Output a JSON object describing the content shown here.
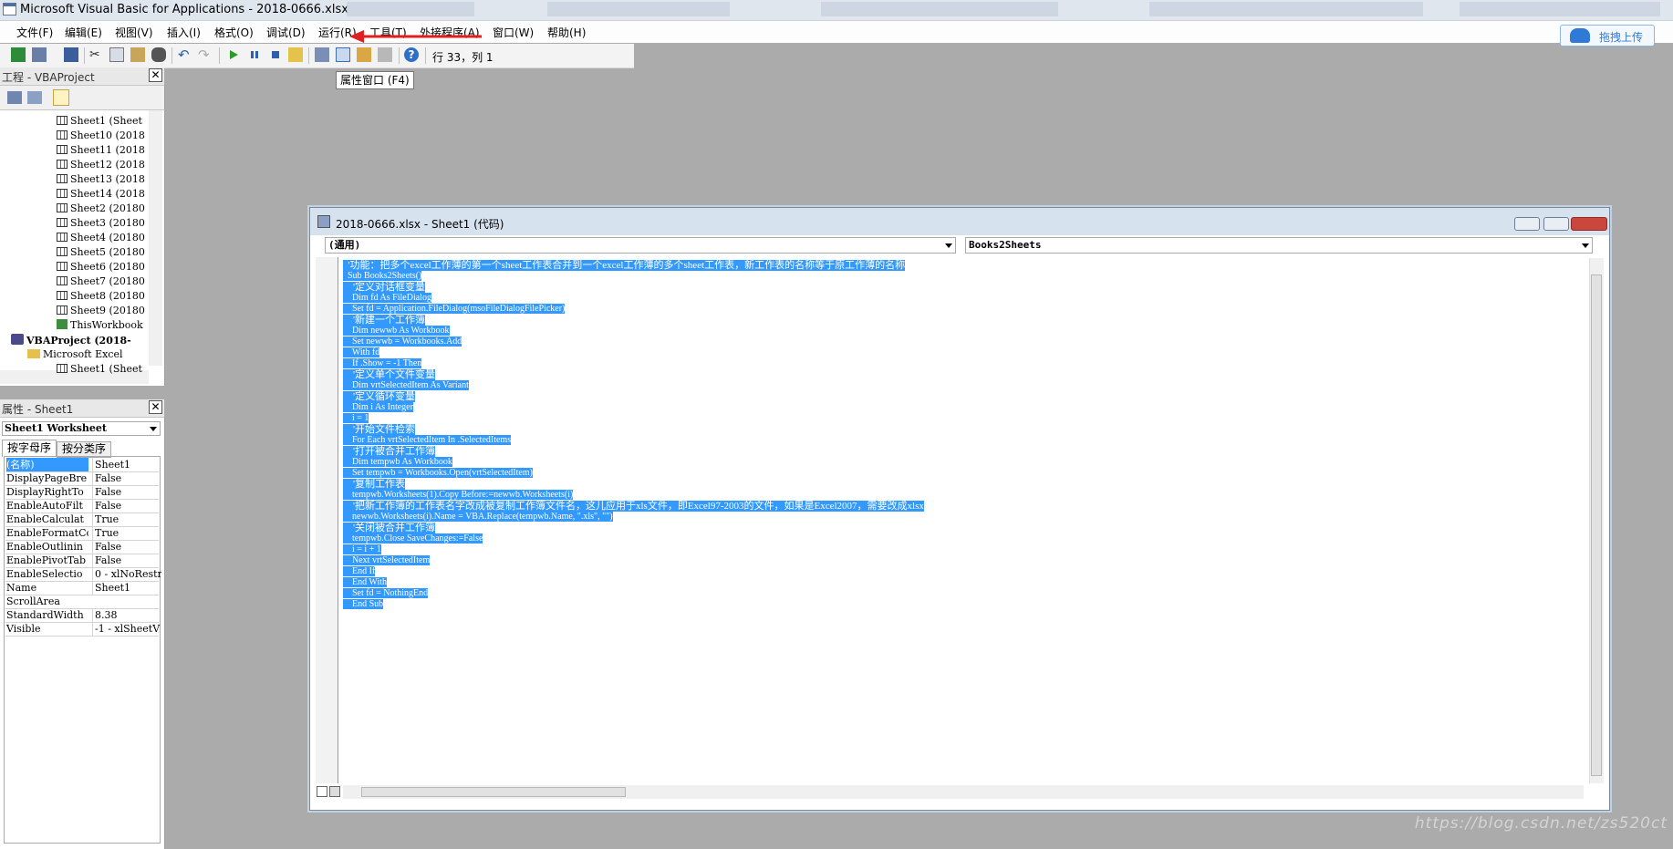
{
  "window": {
    "title": "Microsoft Visual Basic for Applications - 2018-0666.xlsx"
  },
  "menu": {
    "items": [
      "文件(F)",
      "编辑(E)",
      "视图(V)",
      "插入(I)",
      "格式(O)",
      "调试(D)",
      "运行(R)",
      "工具(T)",
      "外接程序(A)",
      "窗口(W)",
      "帮助(H)"
    ]
  },
  "upload_button": {
    "label": "拖拽上传"
  },
  "toolbar": {
    "position_text": "行 33，列 1",
    "tooltip": "属性窗口 (F4)"
  },
  "project_pane": {
    "title": "工程 - VBAProject",
    "tree": [
      {
        "label": "Sheet1 (Sheet",
        "kind": "sheet"
      },
      {
        "label": "Sheet10 (2018",
        "kind": "sheet"
      },
      {
        "label": "Sheet11 (2018",
        "kind": "sheet"
      },
      {
        "label": "Sheet12 (2018",
        "kind": "sheet"
      },
      {
        "label": "Sheet13 (2018",
        "kind": "sheet"
      },
      {
        "label": "Sheet14 (2018",
        "kind": "sheet"
      },
      {
        "label": "Sheet2 (20180",
        "kind": "sheet"
      },
      {
        "label": "Sheet3 (20180",
        "kind": "sheet"
      },
      {
        "label": "Sheet4 (20180",
        "kind": "sheet"
      },
      {
        "label": "Sheet5 (20180",
        "kind": "sheet"
      },
      {
        "label": "Sheet6 (20180",
        "kind": "sheet"
      },
      {
        "label": "Sheet7 (20180",
        "kind": "sheet"
      },
      {
        "label": "Sheet8 (20180",
        "kind": "sheet"
      },
      {
        "label": "Sheet9 (20180",
        "kind": "sheet"
      },
      {
        "label": "ThisWorkbook",
        "kind": "workbook"
      },
      {
        "label": "VBAProject (2018-",
        "kind": "project"
      },
      {
        "label": "Microsoft Excel",
        "kind": "folder"
      },
      {
        "label": "Sheet1 (Sheet",
        "kind": "sheet"
      }
    ]
  },
  "properties_pane": {
    "title": "属性 - Sheet1",
    "object_combo": "Sheet1 Worksheet",
    "tabs": [
      "按字母序",
      "按分类序"
    ],
    "rows": [
      {
        "name": "(名称)",
        "value": "Sheet1"
      },
      {
        "name": "DisplayPageBre",
        "value": "False"
      },
      {
        "name": "DisplayRightTo",
        "value": "False"
      },
      {
        "name": "EnableAutoFilt",
        "value": "False"
      },
      {
        "name": "EnableCalculat",
        "value": "True"
      },
      {
        "name": "EnableFormatCo",
        "value": "True"
      },
      {
        "name": "EnableOutlinin",
        "value": "False"
      },
      {
        "name": "EnablePivotTab",
        "value": "False"
      },
      {
        "name": "EnableSelectio",
        "value": "0 - xlNoRestr"
      },
      {
        "name": "Name",
        "value": "Sheet1"
      },
      {
        "name": "ScrollArea",
        "value": ""
      },
      {
        "name": "StandardWidth",
        "value": "8.38"
      },
      {
        "name": "Visible",
        "value": "-1 - xlSheetV"
      }
    ]
  },
  "code_window": {
    "title": "2018-0666.xlsx - Sheet1 (代码)",
    "object_combo": "(通用)",
    "procedure_combo": "Books2Sheets",
    "lines": [
      "  '功能：把多个excel工作薄的第一个sheet工作表合并到一个excel工作薄的多个sheet工作表，新工作表的名称等于原工作薄的名称",
      "  Sub Books2Sheets()",
      "    '定义对话框变量",
      "    Dim fd As FileDialog",
      "    Set fd = Application.FileDialog(msoFileDialogFilePicker)",
      "    '新建一个工作簿",
      "    Dim newwb As Workbook",
      "    Set newwb = Workbooks.Add",
      "    With fd",
      "    If .Show = -1 Then",
      "    '定义单个文件变量",
      "    Dim vrtSelectedItem As Variant",
      "    '定义循环变量",
      "    Dim i As Integer",
      "    i = 1",
      "    '开始文件检索",
      "    For Each vrtSelectedItem In .SelectedItems",
      "    '打开被合并工作簿",
      "    Dim tempwb As Workbook",
      "    Set tempwb = Workbooks.Open(vrtSelectedItem)",
      "    '复制工作表",
      "    tempwb.Worksheets(1).Copy Before:=newwb.Worksheets(i)",
      "    '把新工作簿的工作表名字改成被复制工作簿文件名，这儿应用于xls文件，即Excel97-2003的文件，如果是Excel2007，需要改成xlsx",
      "    newwb.Worksheets(i).Name = VBA.Replace(tempwb.Name, \".xls\", \"\")",
      "    '关闭被合并工作簿",
      "    tempwb.Close SaveChanges:=False",
      "    i = i + 1",
      "    Next vrtSelectedItem",
      "    End If",
      "    End With",
      "    Set fd = NothingEnd",
      "    End Sub"
    ]
  },
  "watermark": "https://blog.csdn.net/zs520ct",
  "colors": {
    "selection": "#3399ff",
    "workspace": "#ababab",
    "arrow": "#e02020",
    "upload_accent": "#2f7ad6"
  }
}
